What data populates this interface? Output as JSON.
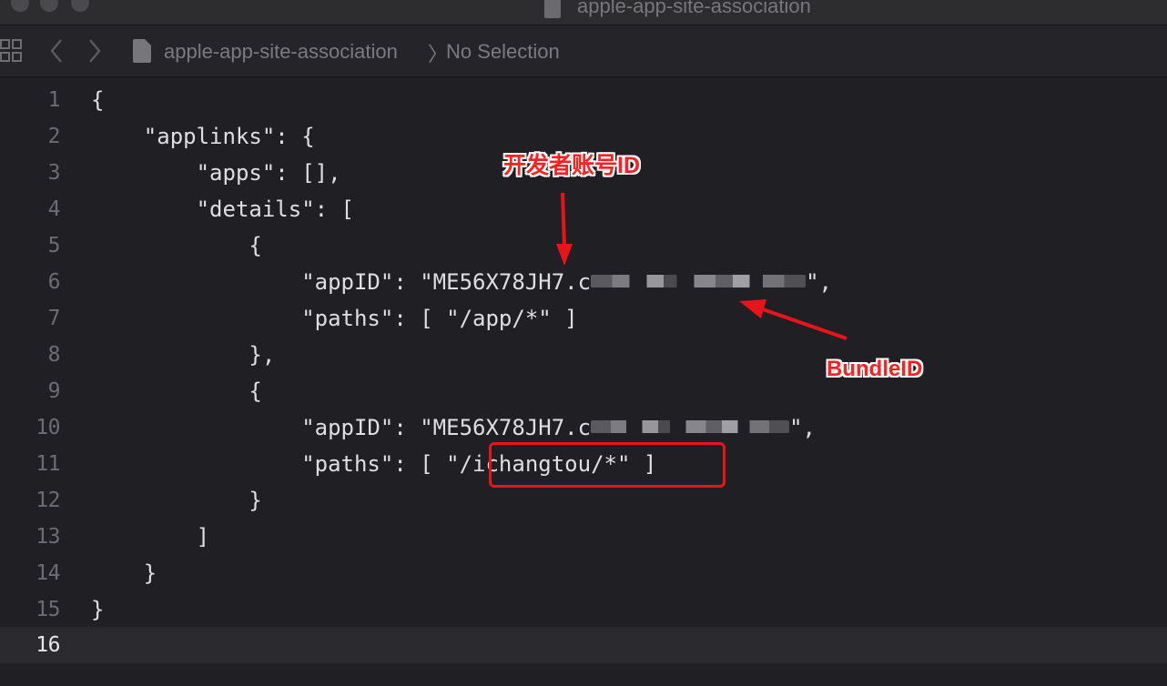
{
  "window": {
    "title": "apple-app-site-association"
  },
  "jumpbar": {
    "file_name": "apple-app-site-association",
    "separator": "〉",
    "selection": "No Selection"
  },
  "icons": {
    "grid": "related-items-grid-icon",
    "back": "chevron-left-icon",
    "forward": "chevron-right-icon",
    "file": "document-icon"
  },
  "editor": {
    "current_line": 16,
    "lines": [
      {
        "number": "1",
        "text": "{"
      },
      {
        "number": "2",
        "text": "    \"applinks\": {"
      },
      {
        "number": "3",
        "text": "        \"apps\": [],"
      },
      {
        "number": "4",
        "text": "        \"details\": ["
      },
      {
        "number": "5",
        "text": "            {"
      },
      {
        "number": "6",
        "text_before": "                \"appID\": \"ME56X78JH7.c",
        "text_after": "\","
      },
      {
        "number": "7",
        "text": "                \"paths\": [ \"/app/*\" ]"
      },
      {
        "number": "8",
        "text": "            },"
      },
      {
        "number": "9",
        "text": "            {"
      },
      {
        "number": "10",
        "text_before": "                \"appID\": \"ME56X78JH7.c",
        "text_after": "\","
      },
      {
        "number": "11",
        "text": "                \"paths\": [ \"/ichangtou/*\" ]"
      },
      {
        "number": "12",
        "text": "            }"
      },
      {
        "number": "13",
        "text": "        ]"
      },
      {
        "number": "14",
        "text": "    }"
      },
      {
        "number": "15",
        "text": "}"
      },
      {
        "number": "16",
        "text": ""
      }
    ]
  },
  "annotations": {
    "developer_id_label": "开发者账号ID",
    "bundle_id_label": "BundleID",
    "color": "#ff2020"
  },
  "colors": {
    "background": "#1f1f24",
    "current_line": "#2a2a2f",
    "code_text": "#dfdfe3",
    "gutter_text": "#6c6c72",
    "annotation_red": "#e8141b"
  }
}
